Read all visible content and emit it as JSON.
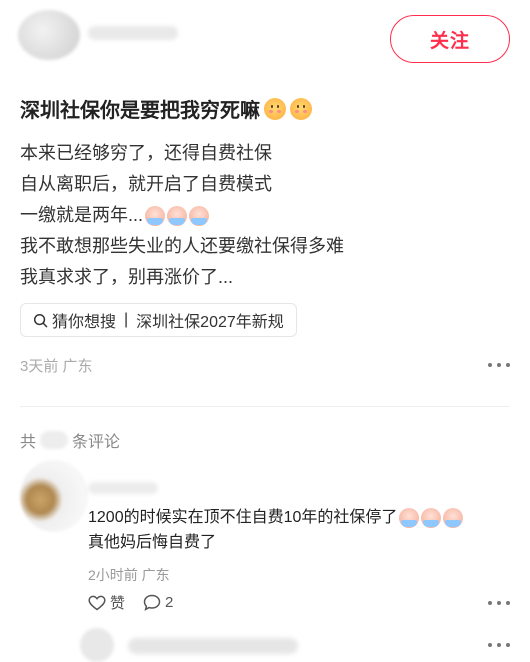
{
  "post": {
    "follow_label": "关注",
    "title": "深圳社保你是要把我穷死嘛",
    "title_emojis": [
      "pleading-face-icon",
      "pleading-face-icon"
    ],
    "lines": [
      "本来已经够穷了，还得自费社保",
      "自从离职后，就开启了自费模式",
      "一缴就是两年...",
      "我不敢想那些失业的人还要缴社保得多难",
      "我真求求了，别再涨价了..."
    ],
    "line3_emojis": [
      "crying-face-icon",
      "crying-face-icon",
      "crying-face-icon"
    ],
    "search_prefix": "猜你想搜",
    "search_query": "深圳社保2027年新规",
    "meta": "3天前  广东"
  },
  "comments": {
    "count_prefix": "共",
    "count_suffix": "条评论",
    "items": [
      {
        "text_line1": "1200的时候实在顶不住自费10年的社保停了",
        "text_line2": "真他妈后悔自费了",
        "meta": "2小时前  广东",
        "like_label": "赞",
        "reply_count": "2"
      }
    ]
  },
  "colors": {
    "accent": "#ff2e4d",
    "text": "#222222",
    "muted": "#aaaaaa"
  }
}
